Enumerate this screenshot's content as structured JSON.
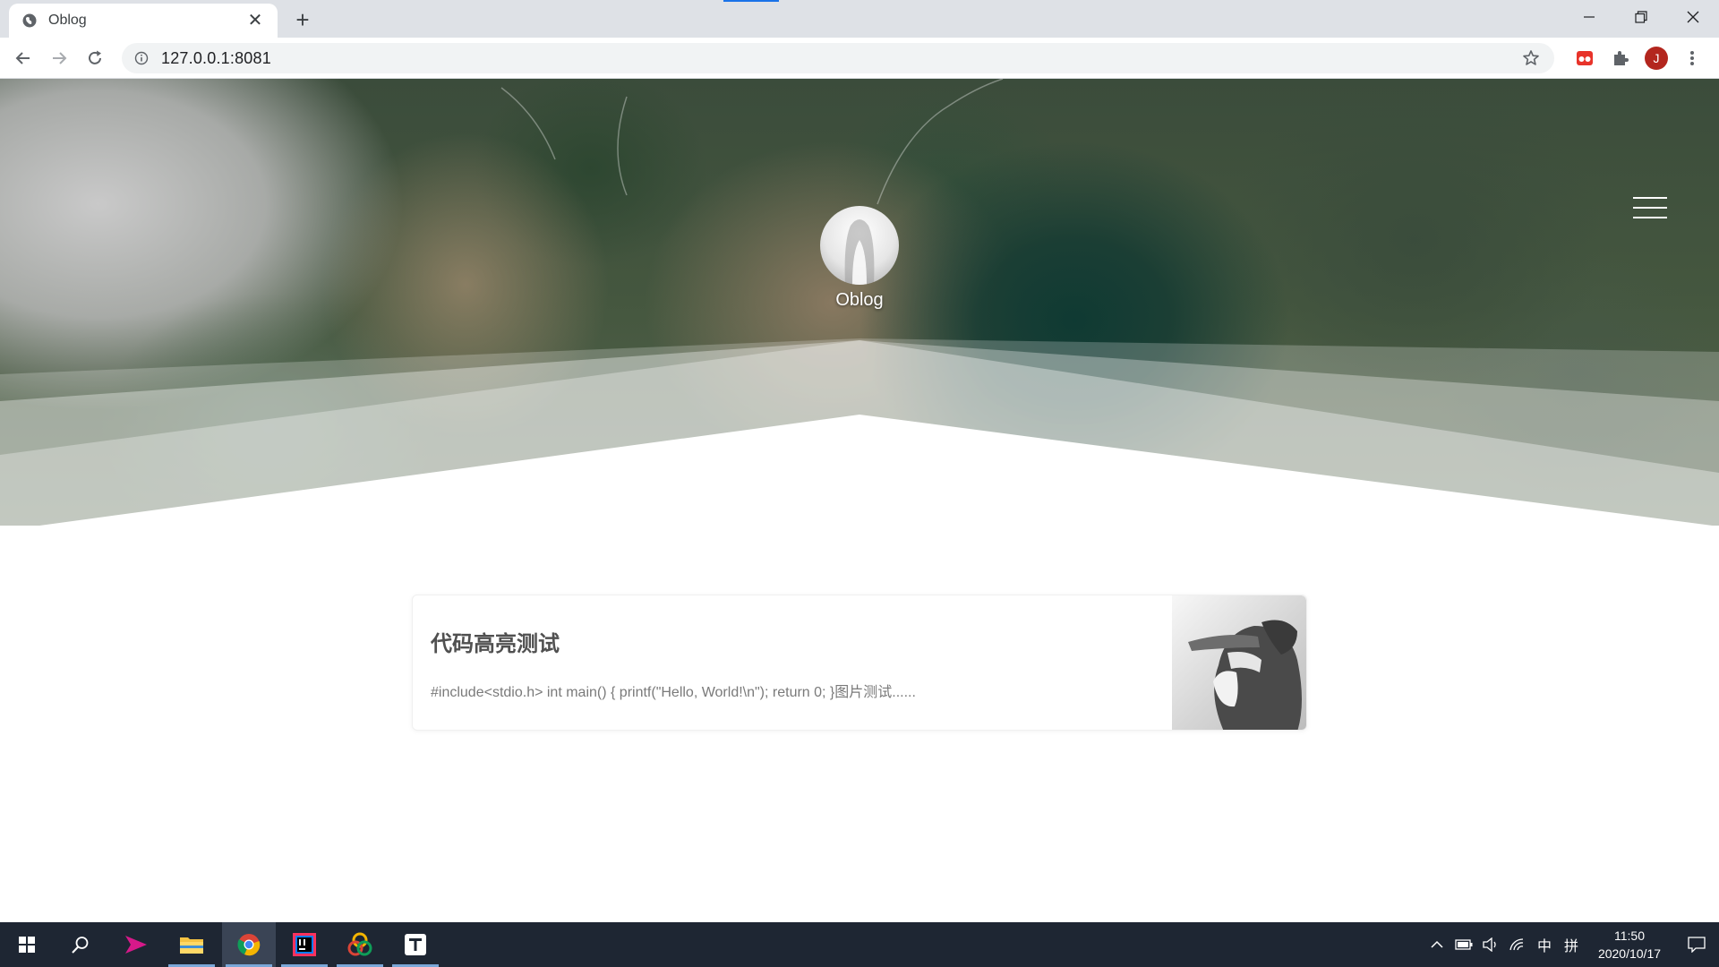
{
  "browser": {
    "tab": {
      "title": "Oblog",
      "close_symbol": "✕"
    },
    "new_tab_symbol": "+",
    "address": {
      "url": "127.0.0.1:8081"
    },
    "profile_initial": "J"
  },
  "site": {
    "title": "Oblog"
  },
  "posts": [
    {
      "title": "代码高亮测试",
      "excerpt": "#include<stdio.h> int main() { printf(\"Hello, World!\\n\"); return 0; }图片测试......"
    }
  ],
  "taskbar": {
    "tray_ime": "中",
    "tray_ime_mode": "拼",
    "clock_time": "11:50",
    "clock_date": "2020/10/17"
  },
  "colors": {
    "accent": "#1a73e8",
    "avatar_bg": "#b3261e",
    "taskbar_bg": "#1e2633"
  }
}
